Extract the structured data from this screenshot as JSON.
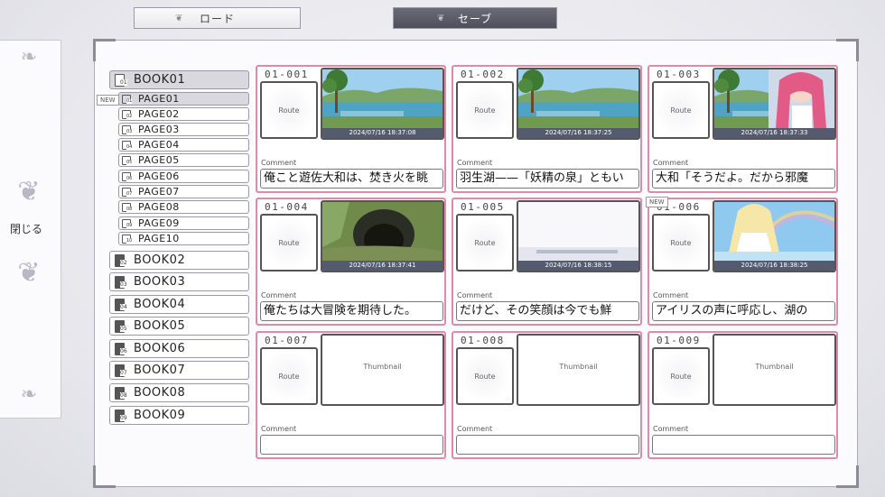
{
  "tabs": {
    "load": "ロード",
    "save": "セーブ"
  },
  "close_label": "閉じる",
  "tree": {
    "books": [
      "BOOK01",
      "BOOK02",
      "BOOK03",
      "BOOK04",
      "BOOK05",
      "BOOK06",
      "BOOK07",
      "BOOK08",
      "BOOK09"
    ],
    "book_icon_numbers": [
      "01",
      "02",
      "03",
      "04",
      "05",
      "06",
      "07",
      "08",
      "09"
    ],
    "pages": [
      "PAGE01",
      "PAGE02",
      "PAGE03",
      "PAGE04",
      "PAGE05",
      "PAGE06",
      "PAGE07",
      "PAGE08",
      "PAGE09",
      "PAGE10"
    ],
    "page_icon_numbers": [
      "01",
      "02",
      "03",
      "04",
      "05",
      "06",
      "07",
      "08",
      "09",
      "10"
    ],
    "selected_book": "BOOK01",
    "selected_page": "PAGE01",
    "new_tag": "NEW"
  },
  "slots": [
    {
      "id": "01-001",
      "route": "Route",
      "date": "2024/07/16 18:37:08",
      "comment_label": "Comment",
      "comment": "俺こと遊佐大和は、焚き火を眺",
      "scene": "lake"
    },
    {
      "id": "01-002",
      "route": "Route",
      "date": "2024/07/16 18:37:25",
      "comment_label": "Comment",
      "comment": "羽生湖——「妖精の泉」ともい",
      "scene": "lake"
    },
    {
      "id": "01-003",
      "route": "Route",
      "date": "2024/07/16 18:37:33",
      "comment_label": "Comment",
      "comment": "大和「そうだよ。だから邪魔",
      "scene": "girl"
    },
    {
      "id": "01-004",
      "route": "Route",
      "date": "2024/07/16 18:37:41",
      "comment_label": "Comment",
      "comment": "俺たちは大冒険を期待した。",
      "scene": "cave"
    },
    {
      "id": "01-005",
      "route": "Route",
      "date": "2024/07/16 18:38:15",
      "comment_label": "Comment",
      "comment": "だけど、その笑顔は今でも鮮",
      "scene": "white"
    },
    {
      "id": "01-006",
      "route": "Route",
      "date": "2024/07/16 18:38:25",
      "comment_label": "Comment",
      "comment": "アイリスの声に呼応し、湖の",
      "scene": "fairy"
    },
    {
      "id": "01-007",
      "route": "Route",
      "thumb_label": "Thumbnail",
      "comment_label": "Comment",
      "comment": "",
      "scene": "empty"
    },
    {
      "id": "01-008",
      "route": "Route",
      "thumb_label": "Thumbnail",
      "comment_label": "Comment",
      "comment": "",
      "scene": "empty"
    },
    {
      "id": "01-009",
      "route": "Route",
      "thumb_label": "Thumbnail",
      "comment_label": "Comment",
      "comment": "",
      "scene": "empty"
    }
  ],
  "new_slot": "01-006",
  "colors": {
    "slot_border": "#e08aa6",
    "date_bar": "#555b6e",
    "save_tab": "#5b5b68"
  }
}
